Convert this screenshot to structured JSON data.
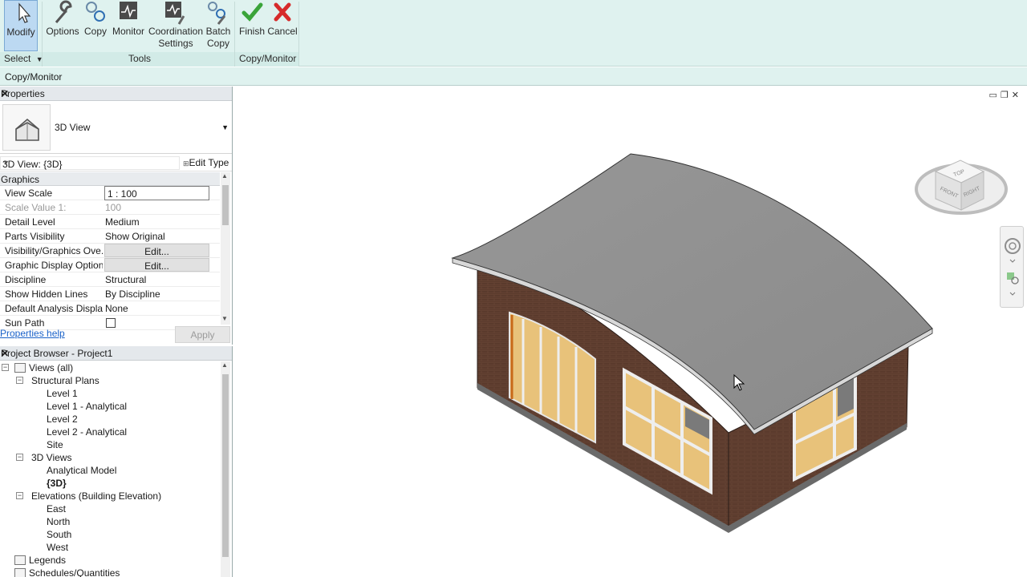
{
  "ribbon": {
    "buttons": [
      {
        "id": "modify",
        "label": "Modify"
      },
      {
        "id": "options",
        "label": "Options"
      },
      {
        "id": "copy",
        "label": "Copy"
      },
      {
        "id": "monitor",
        "label": "Monitor"
      },
      {
        "id": "coordination",
        "label": "Coordination\nSettings",
        "line1": "Coordination",
        "line2": "Settings"
      },
      {
        "id": "batch",
        "label": "Batch Copy",
        "line1": "Batch",
        "line2": "Copy"
      },
      {
        "id": "finish",
        "label": "Finish"
      },
      {
        "id": "cancel",
        "label": "Cancel"
      }
    ],
    "panels": {
      "select": "Select",
      "tools": "Tools",
      "copy_monitor": "Copy/Monitor"
    },
    "colors": {
      "finish": "#3aa43a",
      "cancel": "#d62b2b",
      "active": "#bcd9f2"
    }
  },
  "options_bar": {
    "title": "Copy/Monitor"
  },
  "properties": {
    "title": "Properties",
    "type_name": "3D View",
    "instance": "3D View: {3D}",
    "edit_type": "Edit Type",
    "category": "Graphics",
    "rows": [
      {
        "key": "View Scale",
        "value": "1 : 100",
        "style": "box"
      },
      {
        "key": "Scale Value    1:",
        "value": "100",
        "style": "dim"
      },
      {
        "key": "Detail Level",
        "value": "Medium",
        "style": "text"
      },
      {
        "key": "Parts Visibility",
        "value": "Show Original",
        "style": "text"
      },
      {
        "key": "Visibility/Graphics Ove...",
        "value": "Edit...",
        "style": "button"
      },
      {
        "key": "Graphic Display Options",
        "value": "Edit...",
        "style": "button"
      },
      {
        "key": "Discipline",
        "value": "Structural",
        "style": "text"
      },
      {
        "key": "Show Hidden Lines",
        "value": "By Discipline",
        "style": "text"
      },
      {
        "key": "Default Analysis Displa...",
        "value": "None",
        "style": "text"
      },
      {
        "key": "Sun Path",
        "value": "",
        "style": "checkbox"
      }
    ],
    "help": "Properties help",
    "apply": "Apply"
  },
  "browser": {
    "title": "Project Browser - Project1",
    "nodes": [
      {
        "label": "Views (all)",
        "level": 0,
        "toggle": "−"
      },
      {
        "label": "Structural Plans",
        "level": 1,
        "toggle": "−"
      },
      {
        "label": "Level 1",
        "level": 2
      },
      {
        "label": "Level 1 - Analytical",
        "level": 2
      },
      {
        "label": "Level 2",
        "level": 2
      },
      {
        "label": "Level 2 - Analytical",
        "level": 2
      },
      {
        "label": "Site",
        "level": 2
      },
      {
        "label": "3D Views",
        "level": 1,
        "toggle": "−"
      },
      {
        "label": "Analytical Model",
        "level": 2
      },
      {
        "label": "{3D}",
        "level": 2,
        "selected": true
      },
      {
        "label": "Elevations (Building Elevation)",
        "level": 1,
        "toggle": "−"
      },
      {
        "label": "East",
        "level": 2
      },
      {
        "label": "North",
        "level": 2
      },
      {
        "label": "South",
        "level": 2
      },
      {
        "label": "West",
        "level": 2
      },
      {
        "label": "Legends",
        "level": 0
      },
      {
        "label": "Schedules/Quantities",
        "level": 0
      }
    ]
  },
  "viewcube": {
    "top": "TOP",
    "front": "FRONT",
    "right": "RIGHT"
  },
  "scene": {
    "colors": {
      "roof": "#8e8e8e",
      "brick": "#5a3a2c",
      "glass": "#e8c27a",
      "frame": "#eeeeee"
    }
  }
}
